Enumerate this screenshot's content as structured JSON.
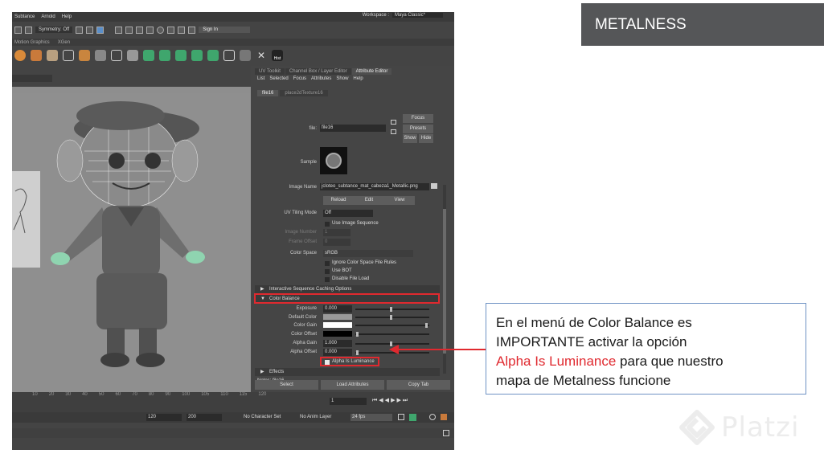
{
  "maya": {
    "menubar": {
      "items": [
        "Subtance",
        "Arnold",
        "Help"
      ],
      "workspace_label": "Workspace :",
      "workspace_value": "Maya Classic*"
    },
    "toolbar": {
      "symmetry": "Symmetry: Off",
      "signin": "Sign In"
    },
    "shelf_tabs": [
      "Motion Graphics",
      "XGen"
    ],
    "shelf_icon_label": "Hist",
    "panel": {
      "tabs": [
        "UV Toolkit",
        "Channel Box / Layer Editor",
        "Attribute Editor"
      ],
      "menu": [
        "List",
        "Selected",
        "Focus",
        "Attributes",
        "Show",
        "Help"
      ],
      "node_tabs": [
        "file16",
        "place2dTexture16"
      ],
      "file_label": "file:",
      "file_value": "file16",
      "focus": "Focus",
      "presets": "Presets",
      "show": "Show",
      "hide": "Hide",
      "sample_label": "Sample",
      "image_name_label": "Image Name",
      "image_name_value": "jcloteo_subtance_mat_cabeza1_Metallic.png",
      "reload": "Reload",
      "edit": "Edit",
      "view": "View",
      "uv_tiling_label": "UV Tiling Mode",
      "uv_tiling_value": "Off",
      "use_image_sequence": "Use Image Sequence",
      "image_number_label": "Image Number",
      "image_number_value": "1",
      "frame_offset_label": "Frame Offset",
      "frame_offset_value": "0",
      "color_space_label": "Color Space",
      "color_space_value": "sRGB",
      "ignore_rules": "Ignore Color Space File Rules",
      "use_bot": "Use BOT",
      "disable_file_load": "Disable File Load",
      "section_caching": "Interactive Sequence Caching Options",
      "section_color_balance": "Color Balance",
      "exposure_label": "Exposure",
      "exposure_value": "0.000",
      "default_color_label": "Default Color",
      "color_gain_label": "Color Gain",
      "color_offset_label": "Color Offset",
      "alpha_gain_label": "Alpha Gain",
      "alpha_gain_value": "1.000",
      "alpha_offset_label": "Alpha Offset",
      "alpha_offset_value": "0.000",
      "alpha_is_luminance": "Alpha Is Luminance",
      "section_effects": "Effects",
      "notes": "Notes:  file16",
      "select": "Select",
      "load_attributes": "Load Attributes",
      "copy_tab": "Copy Tab"
    },
    "timeline": {
      "ticks": [
        "10",
        "20",
        "30",
        "40",
        "50",
        "60",
        "70",
        "80",
        "90",
        "100",
        "105",
        "110",
        "115",
        "120"
      ],
      "current_frame": "1"
    },
    "range": {
      "end": "120",
      "max": "200",
      "character_set": "No Character Set",
      "anim_layer": "No Anim Layer",
      "fps": "24 fps"
    }
  },
  "slide": {
    "title": "METALNESS",
    "note_line1": "En el menú de Color Balance es",
    "note_line2": "IMPORTANTE activar la opción",
    "note_highlight": "Alpha Is Luminance",
    "note_line3_rest": " para que nuestro",
    "note_line4": "mapa de Metalness funcione",
    "watermark": "Platzi"
  },
  "colors": {
    "accent_red": "#e0292f",
    "note_border": "#6f93c4",
    "title_bg": "#555658"
  }
}
